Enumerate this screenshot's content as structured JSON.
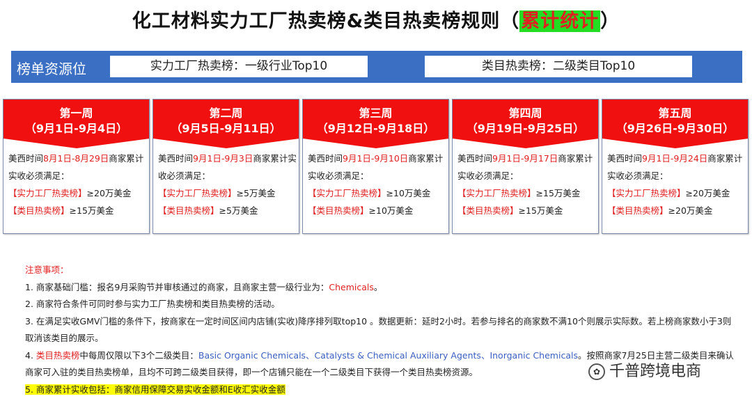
{
  "title": {
    "main": "化工材料实力工厂热卖榜&类目热卖榜规则（",
    "highlight": "累计统计",
    "close": "）"
  },
  "source": {
    "label": "榜单资源位",
    "items": [
      "实力工厂热卖榜：一级行业Top10",
      "类目热卖榜：二级类目Top10"
    ]
  },
  "weeks": [
    {
      "name": "第一周",
      "range": "（9月1日-9月4日）",
      "pre": "美西时间",
      "time": "8月1日-8月29日",
      "post": "商家累计实收必须满足：",
      "f_label": "【实力工厂热卖榜】",
      "f_val": "≥20万美金",
      "c_label": "【类目热卖榜】",
      "c_val": "≥15万美金"
    },
    {
      "name": "第二周",
      "range": "（9月5日-9月11日）",
      "pre": "美西时间",
      "time": "9月1日-9月3日",
      "post": "商家累计实收必须满足：",
      "f_label": "【实力工厂热卖榜】",
      "f_val": "≥5万美金",
      "c_label": "【类目热卖榜】",
      "c_val": "≥5万美金"
    },
    {
      "name": "第三周",
      "range": "（9月12日-9月18日）",
      "pre": "美西时间",
      "time": "9月1日-9月10日",
      "post": "商家累计实收必须满足：",
      "f_label": "【实力工厂热卖榜】",
      "f_val": "≥10万美金",
      "c_label": "【类目热卖榜】",
      "c_val": "≥10万美金"
    },
    {
      "name": "第四周",
      "range": "（9月19日-9月25日）",
      "pre": "美西时间",
      "time": "9月1日-9月17日",
      "post": "商家累计实收必须满足：",
      "f_label": "【实力工厂热卖榜】",
      "f_val": "≥15万美金",
      "c_label": "【类目热卖榜】",
      "c_val": "≥15万美金"
    },
    {
      "name": "第五周",
      "range": "（9月26日-9月30日）",
      "pre": "美西时间",
      "time": "9月1日-9月24日",
      "post": "商家累计实收必须满足：",
      "f_label": "【实力工厂热卖榜】",
      "f_val": "≥20万美金",
      "c_label": "【类目热卖榜】",
      "c_val": "≥20万美金"
    }
  ],
  "notes": {
    "heading": "注意事项：",
    "n1_pre": "1. 商家基础门槛：报名9月采购节并审核通过的商家，且商家主营一级行业为：",
    "n1_red": "Chemicals",
    "n1_post": "。",
    "n2": "2. 商家符合条件可同时参与实力工厂热卖榜和类目热卖榜的活动。",
    "n3": "3. 在满足实收GMV门槛的条件下，按商家在一定时间区间内店铺(实收)降序排列取top10 。数据更新：延时2小时。若参与排名的商家数不满10个则展示实际数。若上榜商家数小于3则取消该类目的展示。",
    "n4_pre": "4. ",
    "n4_red": "类目热卖榜",
    "n4_mid": "中每周仅限以下3个二级类目：",
    "n4_blue": "Basic Organic Chemicals、Catalysts & Chemical Auxiliary Agents、Inorganic Chemicals",
    "n4_post": "。按照商家7月25日主营二级类目来确认商家可入驻的类目热卖榜单，且均不可跨二级类目获得，即一个店铺只能在一个二级类目下获得一个类目热卖榜资源。",
    "n5": "5. 商家累计实收包括：商家信用保障交易实收金额和E收汇实收金额"
  },
  "watermark": "千普跨境电商"
}
